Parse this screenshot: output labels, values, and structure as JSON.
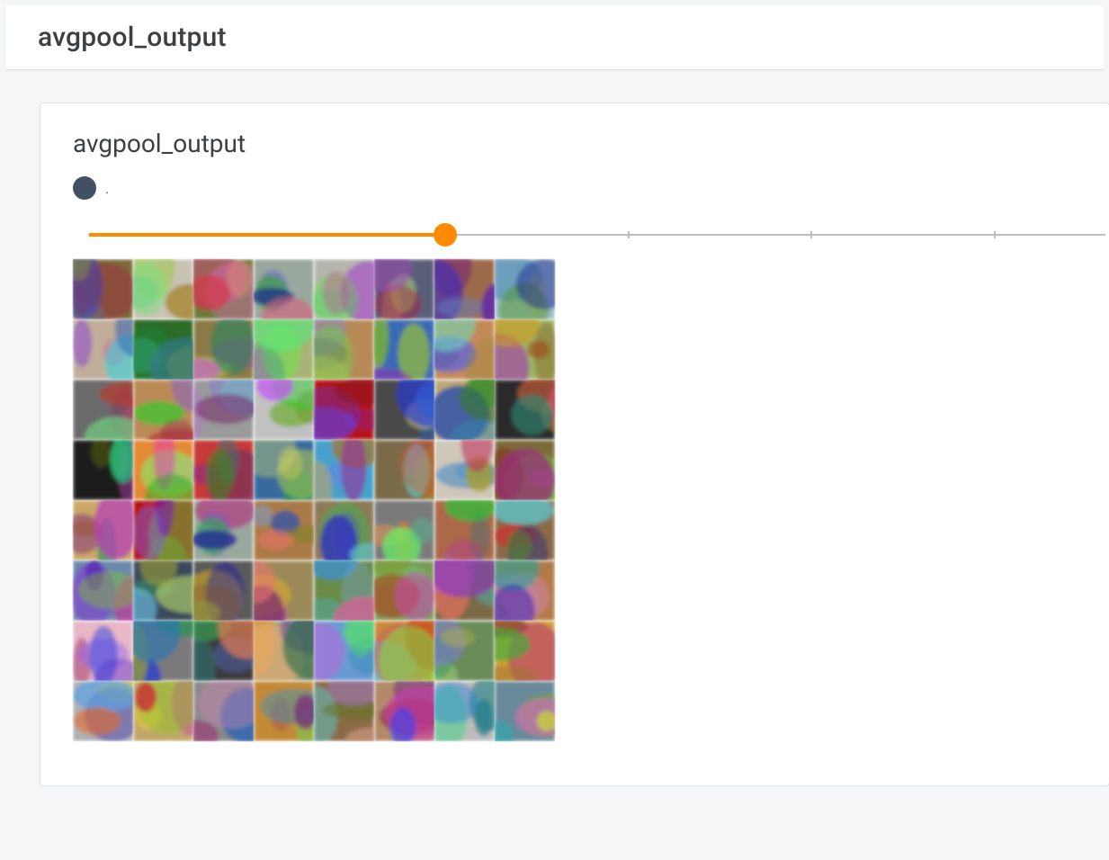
{
  "header": {
    "title": "avgpool_output"
  },
  "card": {
    "title": "avgpool_output",
    "legend": {
      "label": "."
    },
    "slider": {
      "percent": 35,
      "ticks_percent": [
        35,
        53,
        71,
        89
      ]
    },
    "grid": {
      "cols": 8,
      "rows": 8,
      "tiles": [
        [
          "#7a6b3a",
          "#c9c2b4",
          "#6a7a3b",
          "#9aa79c",
          "#b6b5ad",
          "#5a5e78",
          "#9a6a4d",
          "#9fbfc8"
        ],
        [
          "#bfae9a",
          "#2e6b2a",
          "#8a7a4a",
          "#a8b47a",
          "#b38a5a",
          "#3e6bb0",
          "#c18a5a",
          "#9fb66a"
        ],
        [
          "#6a6a6a",
          "#b88a5a",
          "#9a9a9a",
          "#c1c1c1",
          "#b01818",
          "#4a4a4a",
          "#bca97a",
          "#2a2a2a"
        ],
        [
          "#1a1a1a",
          "#e08a3a",
          "#c13a3a",
          "#3a6a9a",
          "#4aa0c8",
          "#7a6a4a",
          "#cfc7ba",
          "#7a6a3a"
        ],
        [
          "#c9a86a",
          "#b01818",
          "#9aa79c",
          "#a87a4a",
          "#8a7a5a",
          "#7a7a7a",
          "#a86a4a",
          "#8a6a4a"
        ],
        [
          "#6a8aa8",
          "#3a4a5a",
          "#5a5a5a",
          "#9a8a5a",
          "#6a8a4a",
          "#7a9a5a",
          "#7a6a4a",
          "#b07a4a"
        ],
        [
          "#e6b8c8",
          "#7a7a7a",
          "#3a3a3a",
          "#9a9a7a",
          "#6a9ad0",
          "#c88a3a",
          "#6a8a5a",
          "#d0a03a"
        ],
        [
          "#b0b0b0",
          "#c0a86a",
          "#8a8a8a",
          "#c08a3a",
          "#8a6a4a",
          "#b08a6a",
          "#bcbcbc",
          "#6a8a9a"
        ]
      ]
    }
  }
}
